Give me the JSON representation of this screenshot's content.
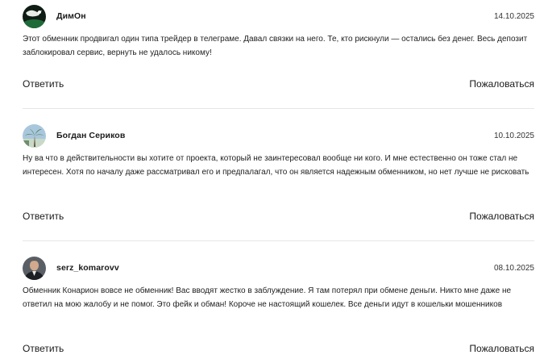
{
  "comments": [
    {
      "author": "ДимОн",
      "date": "14.10.2025",
      "text": "Этот обменник продвигал один типа трейдер в телеграме. Давал связки на него. Те, кто рискнули — остались без денег. Весь депозит заблокировал сервис, вернуть не удалось никому!",
      "reply_label": "Ответить",
      "report_label": "Пожаловаться",
      "avatar_icon": "avatar-dark-green-photo"
    },
    {
      "author": "Богдан Сериков",
      "date": "10.10.2025",
      "text": "Ну ва что в действительности вы хотите от проекта, который не заинтересовал вообще ни кого. И мне естественно он тоже стал не интересен. Хотя по началу даже рассматривал его и предпалагал, что он является надежным обменником, но нет лучше не рисковать",
      "reply_label": "Ответить",
      "report_label": "Пожаловаться",
      "avatar_icon": "avatar-palm-tree-photo"
    },
    {
      "author": "serz_komarovv",
      "date": "08.10.2025",
      "text": "Обменник Конарион вовсе не обменник! Вас вводят жестко в заблуждение. Я там потерял при обмене деньги. Никто мне даже не ответил на мою жалобу и не помог. Это фейк и обман! Короче не настоящий кошелек. Все деньги идут в кошельки мошенников",
      "reply_label": "Ответить",
      "report_label": "Пожаловаться",
      "avatar_icon": "avatar-man-portrait-photo"
    }
  ]
}
